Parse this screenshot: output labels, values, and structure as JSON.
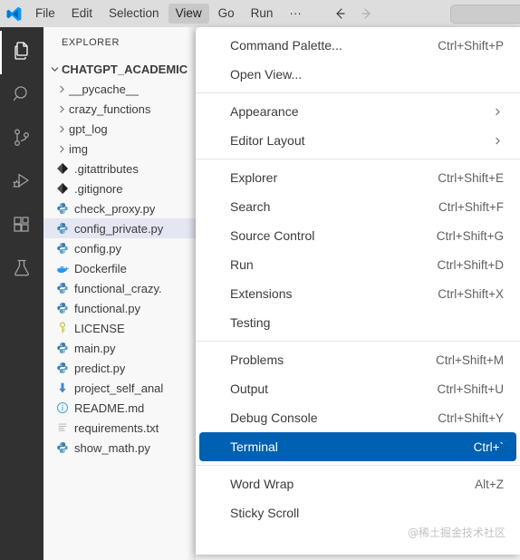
{
  "titlebar": {
    "logo_icon": "vscode-logo-icon",
    "menus": [
      {
        "label": "File",
        "active": false
      },
      {
        "label": "Edit",
        "active": false
      },
      {
        "label": "Selection",
        "active": false
      },
      {
        "label": "View",
        "active": true
      },
      {
        "label": "Go",
        "active": false
      },
      {
        "label": "Run",
        "active": false
      },
      {
        "label": "···",
        "active": false
      }
    ],
    "nav": {
      "back_icon": "arrow-left-icon",
      "forward_icon": "arrow-right-icon"
    },
    "search": {
      "value": "",
      "placeholder": ""
    }
  },
  "activitybar": {
    "items": [
      {
        "name": "explorer",
        "icon": "files-icon",
        "active": true
      },
      {
        "name": "search",
        "icon": "search-icon",
        "active": false
      },
      {
        "name": "source-control",
        "icon": "source-control-icon",
        "active": false
      },
      {
        "name": "run-and-debug",
        "icon": "run-debug-icon",
        "active": false
      },
      {
        "name": "extensions",
        "icon": "extensions-icon",
        "active": false
      },
      {
        "name": "testing",
        "icon": "beaker-icon",
        "active": false
      }
    ]
  },
  "sidebar": {
    "title": "EXPLORER",
    "workspace": {
      "label": "CHATGPT_ACADEMIC",
      "expanded": true
    },
    "tree": [
      {
        "label": "__pycache__",
        "type": "folder",
        "icon": "chevron-right-icon",
        "selected": false
      },
      {
        "label": "crazy_functions",
        "type": "folder",
        "icon": "chevron-right-icon",
        "selected": false
      },
      {
        "label": "gpt_log",
        "type": "folder",
        "icon": "chevron-right-icon",
        "selected": false
      },
      {
        "label": "img",
        "type": "folder",
        "icon": "chevron-right-icon",
        "selected": false
      },
      {
        "label": ".gitattributes",
        "type": "file",
        "icon": "git-file-icon",
        "selected": false
      },
      {
        "label": ".gitignore",
        "type": "file",
        "icon": "git-file-icon",
        "selected": false
      },
      {
        "label": "check_proxy.py",
        "type": "file",
        "icon": "python-file-icon",
        "selected": false
      },
      {
        "label": "config_private.py",
        "type": "file",
        "icon": "python-file-icon",
        "selected": true
      },
      {
        "label": "config.py",
        "type": "file",
        "icon": "python-file-icon",
        "selected": false
      },
      {
        "label": "Dockerfile",
        "type": "file",
        "icon": "docker-file-icon",
        "selected": false
      },
      {
        "label": "functional_crazy.",
        "type": "file",
        "icon": "python-file-icon",
        "selected": false
      },
      {
        "label": "functional.py",
        "type": "file",
        "icon": "python-file-icon",
        "selected": false
      },
      {
        "label": "LICENSE",
        "type": "file",
        "icon": "key-file-icon",
        "selected": false
      },
      {
        "label": "main.py",
        "type": "file",
        "icon": "python-file-icon",
        "selected": false
      },
      {
        "label": "predict.py",
        "type": "file",
        "icon": "python-file-icon",
        "selected": false
      },
      {
        "label": "project_self_anal",
        "type": "file",
        "icon": "download-file-icon",
        "selected": false
      },
      {
        "label": "README.md",
        "type": "file",
        "icon": "info-file-icon",
        "selected": false
      },
      {
        "label": "requirements.txt",
        "type": "file",
        "icon": "text-file-icon",
        "selected": false
      },
      {
        "label": "show_math.py",
        "type": "file",
        "icon": "python-file-icon",
        "selected": false
      }
    ]
  },
  "view_menu": {
    "groups": [
      {
        "items": [
          {
            "label": "Command Palette...",
            "key": "Ctrl+Shift+P",
            "submenu": false,
            "highlighted": false
          },
          {
            "label": "Open View...",
            "key": "",
            "submenu": false,
            "highlighted": false
          }
        ]
      },
      {
        "items": [
          {
            "label": "Appearance",
            "key": "",
            "submenu": true,
            "highlighted": false
          },
          {
            "label": "Editor Layout",
            "key": "",
            "submenu": true,
            "highlighted": false
          }
        ]
      },
      {
        "items": [
          {
            "label": "Explorer",
            "key": "Ctrl+Shift+E",
            "submenu": false,
            "highlighted": false
          },
          {
            "label": "Search",
            "key": "Ctrl+Shift+F",
            "submenu": false,
            "highlighted": false
          },
          {
            "label": "Source Control",
            "key": "Ctrl+Shift+G",
            "submenu": false,
            "highlighted": false
          },
          {
            "label": "Run",
            "key": "Ctrl+Shift+D",
            "submenu": false,
            "highlighted": false
          },
          {
            "label": "Extensions",
            "key": "Ctrl+Shift+X",
            "submenu": false,
            "highlighted": false
          },
          {
            "label": "Testing",
            "key": "",
            "submenu": false,
            "highlighted": false
          }
        ]
      },
      {
        "items": [
          {
            "label": "Problems",
            "key": "Ctrl+Shift+M",
            "submenu": false,
            "highlighted": false
          },
          {
            "label": "Output",
            "key": "Ctrl+Shift+U",
            "submenu": false,
            "highlighted": false
          },
          {
            "label": "Debug Console",
            "key": "Ctrl+Shift+Y",
            "submenu": false,
            "highlighted": false
          },
          {
            "label": "Terminal",
            "key": "Ctrl+`",
            "submenu": false,
            "highlighted": true
          }
        ]
      },
      {
        "items": [
          {
            "label": "Word Wrap",
            "key": "Alt+Z",
            "submenu": false,
            "highlighted": false
          },
          {
            "label": "Sticky Scroll",
            "key": "",
            "submenu": false,
            "highlighted": false
          }
        ]
      }
    ]
  },
  "watermark": "@稀土掘金技术社区",
  "colors": {
    "titlebar_bg": "#dddddd",
    "activitybar_bg": "#313131",
    "sidebar_bg": "#f8f8f8",
    "menu_bg": "#ffffff",
    "menu_highlight": "#0060b1",
    "selection_bg": "#e4e6f1",
    "text": "#3b3b3b"
  }
}
